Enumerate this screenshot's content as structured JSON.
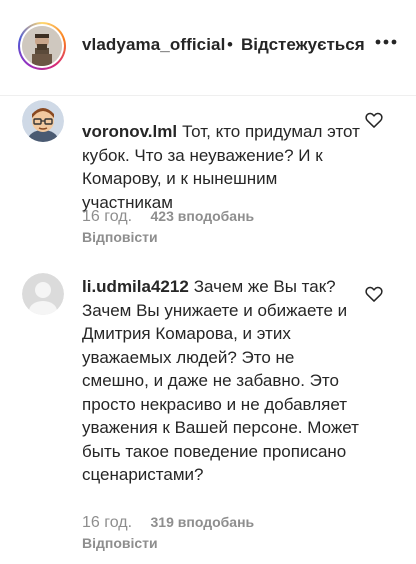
{
  "header": {
    "username": "vladyama_official",
    "separator": "•",
    "follow_status": "Відстежується",
    "more_icon": "more-horizontal-icon"
  },
  "comments": [
    {
      "username": "voronov.lml",
      "text": "Тот, кто придумал этот кубок. Что за неуважение? И к Комарову, и к нынешним участникам",
      "time": "16 год.",
      "likes": "423 вподобань",
      "reply": "Відповісти",
      "avatar": "cartoon-avatar-glasses"
    },
    {
      "username": "li.udmila4212",
      "text": "Зачем же Вы так? Зачем Вы унижаете и обижаете и Дмитрия Комарова, и этих уважаемых людей? Это не смешно, и даже не забавно. Это просто некрасиво и не добавляет уважения к Вашей персоне. Может быть такое поведение прописано сценаристами?",
      "time": "16 год.",
      "likes": "319 вподобань",
      "reply": "Відповісти",
      "avatar": "default-avatar"
    }
  ],
  "colors": {
    "text": "#262626",
    "secondary": "#8e8e8e",
    "border": "#efefef"
  }
}
